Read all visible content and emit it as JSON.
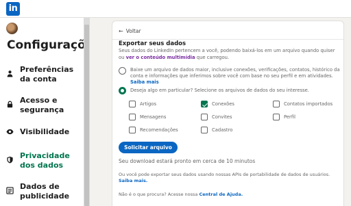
{
  "topbar": {
    "logo_text": "in"
  },
  "sidebar": {
    "title": "Configurações",
    "items": [
      {
        "label": "Preferências da conta",
        "icon": "person-icon"
      },
      {
        "label": "Acesso e segurança",
        "icon": "lock-icon"
      },
      {
        "label": "Visibilidade",
        "icon": "eye-icon"
      },
      {
        "label": "Privacidade dos dados",
        "icon": "shield-icon",
        "active": true
      },
      {
        "label": "Dados de publicidade",
        "icon": "newspaper-icon"
      }
    ]
  },
  "main": {
    "back_label": "Voltar",
    "title": "Exportar seus dados",
    "description_pre": "Seus dados do LinkedIn pertencem a você, podendo baixá-los em um arquivo quando quiser ou ",
    "description_link": "ver o conteúdo multimídia",
    "description_post": " que carregou.",
    "option_large": {
      "text": "Baixe um arquivo de dados maior, inclusive conexões, verificações, contatos, histórico da conta e informações que inferimos sobre você com base no seu perfil e em atividades.",
      "link": "Saiba mais",
      "selected": false
    },
    "option_specific": {
      "text": "Deseja algo em particular? Selecione os arquivos de dados do seu interesse.",
      "selected": true
    },
    "checkboxes": [
      {
        "label": "Artigos",
        "checked": false
      },
      {
        "label": "Conexões",
        "checked": true
      },
      {
        "label": "Contatos importados",
        "checked": false
      },
      {
        "label": "Mensagens",
        "checked": false
      },
      {
        "label": "Convites",
        "checked": false
      },
      {
        "label": "Perfil",
        "checked": false
      },
      {
        "label": "Recomendações",
        "checked": false
      },
      {
        "label": "Cadastro",
        "checked": false
      }
    ],
    "request_button": "Solicitar arquivo",
    "ready_text": "Seu download estará pronto em cerca de 10 minutos",
    "api_text": "Ou você pode exportar seus dados usando nossas APIs de portabilidade de dados de usuários.",
    "api_link": "Saiba mais.",
    "help_text": "Não é o que procura? Acesse nossa ",
    "help_link": "Central de Ajuda."
  },
  "colors": {
    "accent": "#0a66c2",
    "active_green": "#01754f",
    "background": "#f4f2ee"
  }
}
